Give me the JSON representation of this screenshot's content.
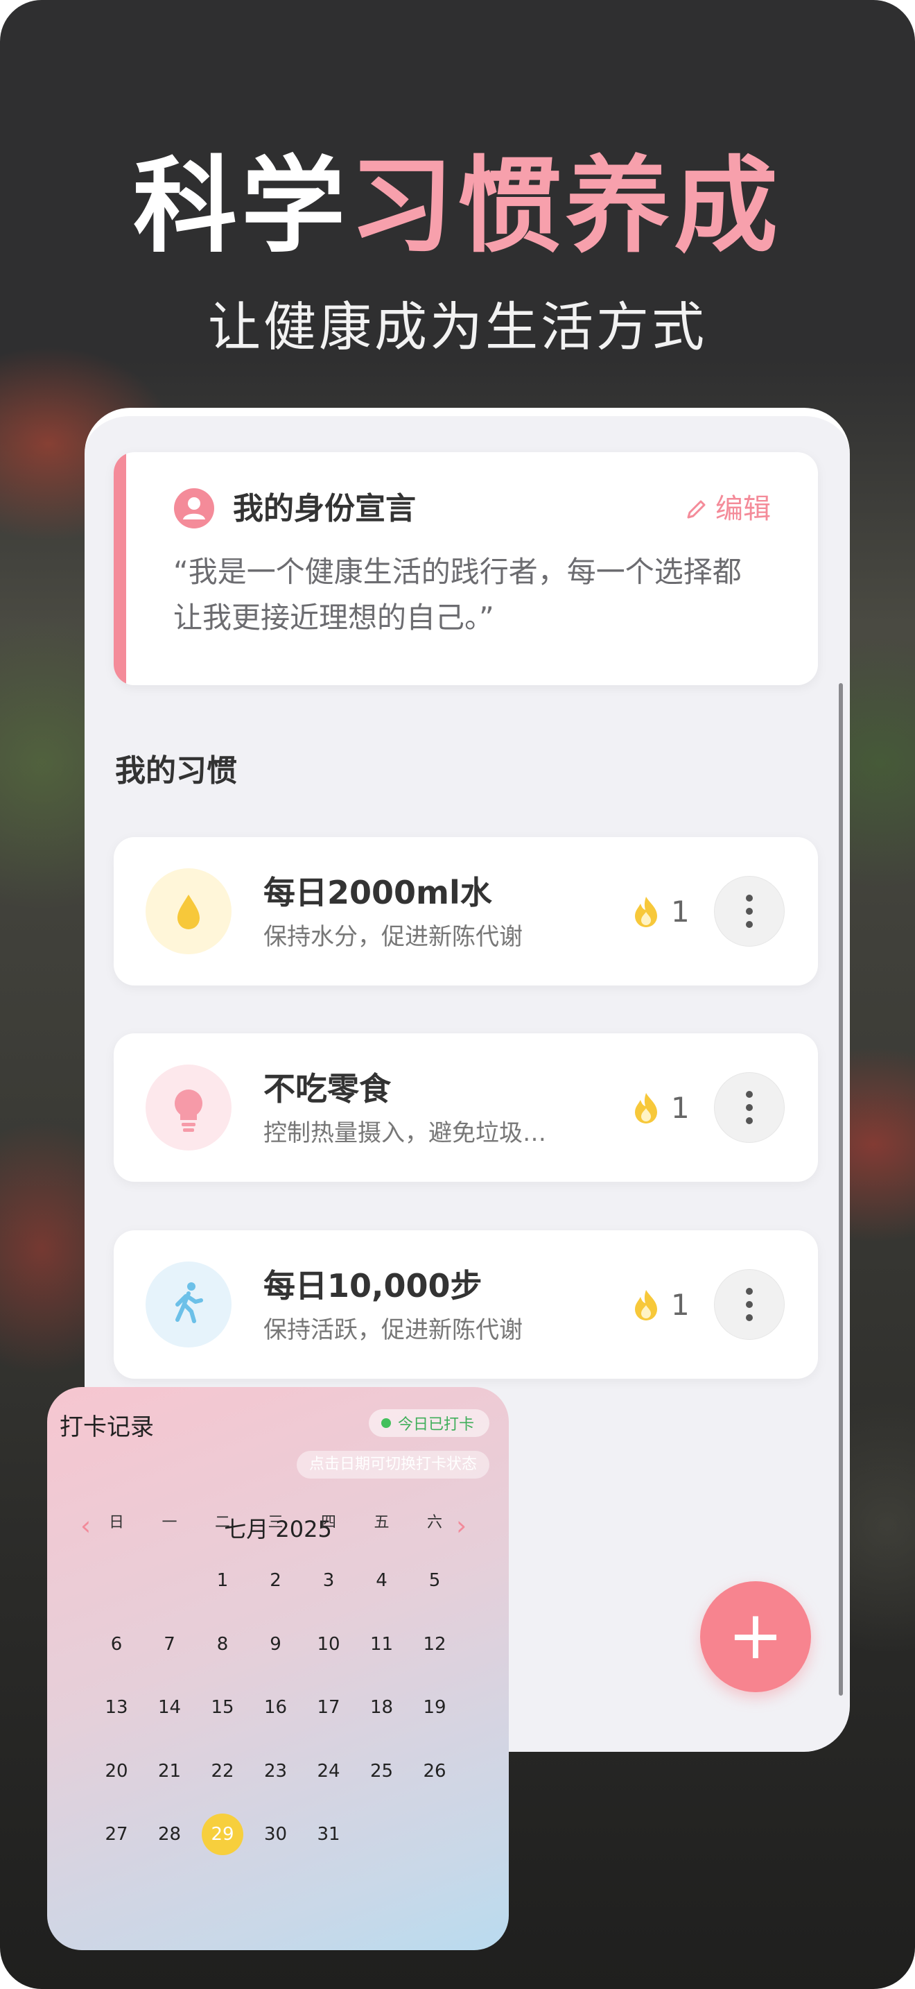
{
  "hero": {
    "title_white": "科学",
    "title_pink": "习惯养成",
    "subtitle": "让健康成为生活方式"
  },
  "declaration": {
    "title": "我的身份宣言",
    "edit_label": "编辑",
    "text": "“我是一个健康生活的践行者，每一个选择都让我更接近理想的自己。”"
  },
  "habits_section": {
    "title": "我的习惯"
  },
  "habits": [
    {
      "name": "每日2000ml水",
      "desc": "保持水分，促进新陈代谢",
      "streak": "1",
      "icon": "water-drop-icon",
      "icon_bg": "#fff6d9",
      "icon_color": "#f7c83a"
    },
    {
      "name": "不吃零食",
      "desc": "控制热量摄入，避免垃圾…",
      "streak": "1",
      "icon": "lightbulb-icon",
      "icon_bg": "#fde8ec",
      "icon_color": "#f69aa8"
    },
    {
      "name": "每日10,000步",
      "desc": "保持活跃，促进新陈代谢",
      "streak": "1",
      "icon": "walking-icon",
      "icon_bg": "#e6f3fb",
      "icon_color": "#6cc0e8"
    }
  ],
  "fab": {
    "label": "+"
  },
  "calendar": {
    "title": "打卡记录",
    "badge": "今日已打卡",
    "hint": "点击日期可切换打卡状态",
    "month_label": "七月 2025",
    "weekdays": [
      "日",
      "一",
      "二",
      "三",
      "四",
      "五",
      "六"
    ],
    "first_weekday": 2,
    "days_in_month": 31,
    "today": 29
  },
  "colors": {
    "accent": "#f48b99",
    "streak_flame": "#f7c83a",
    "checked_in": "#43c05c",
    "today_highlight": "#f7cf3d"
  }
}
